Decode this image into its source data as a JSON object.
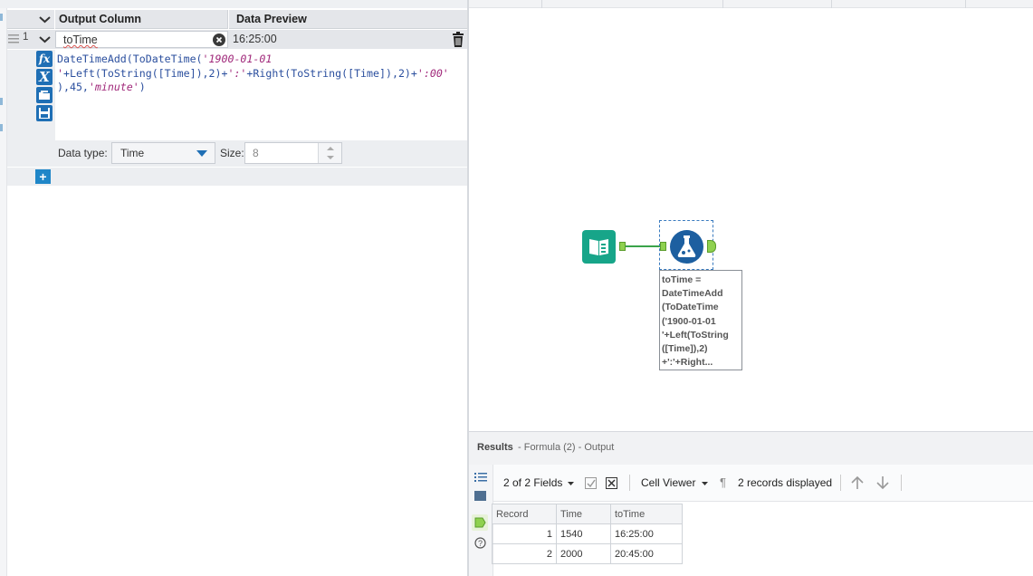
{
  "formula_panel": {
    "header_output_column": "Output Column",
    "header_data_preview": "Data Preview",
    "row_number": "1",
    "output_column_value": "toTime",
    "data_preview_value": "16:25:00",
    "expression_line1_a": "DateTimeAdd(ToDateTime(",
    "expression_line1_b": "'1900-01-01",
    "expression_line2_a": "'",
    "expression_line2_b": "+Left(ToString([Time]),2)+",
    "expression_line2_c": "':'",
    "expression_line2_d": "+Right(ToString([Time]),2)+",
    "expression_line2_e": "':00'",
    "expression_line3_a": "),45,",
    "expression_line3_b": "'minute'",
    "expression_line3_c": ")",
    "data_type_label": "Data type:",
    "data_type_value": "Time",
    "size_label": "Size:",
    "size_value": "8",
    "icons": [
      "fx-icon",
      "variable-icon",
      "open-icon",
      "save-icon"
    ]
  },
  "canvas": {
    "formula_annotation": "toTime =\nDateTimeAdd\n(ToDateTime\n('1900-01-01\n'+Left(ToString\n([Time]),2)\n+':'+Right..."
  },
  "results": {
    "title": "Results",
    "subtitle": "- Formula (2) - Output",
    "fields_button": "2 of 2 Fields",
    "viewer_button": "Cell Viewer",
    "pilcrow": "¶",
    "records_displayed": "2 records displayed",
    "table": {
      "columns": [
        "Record",
        "Time",
        "toTime"
      ],
      "rows": [
        {
          "record": "1",
          "time": "1540",
          "totime": "16:25:00"
        },
        {
          "record": "2",
          "time": "2000",
          "totime": "20:45:00"
        }
      ]
    }
  },
  "colors": {
    "accent_blue": "#1f6fb5",
    "input_tool_teal": "#17a589",
    "formula_tool_blue": "#1d5fa0",
    "anchor_green": "#8fd14f"
  }
}
